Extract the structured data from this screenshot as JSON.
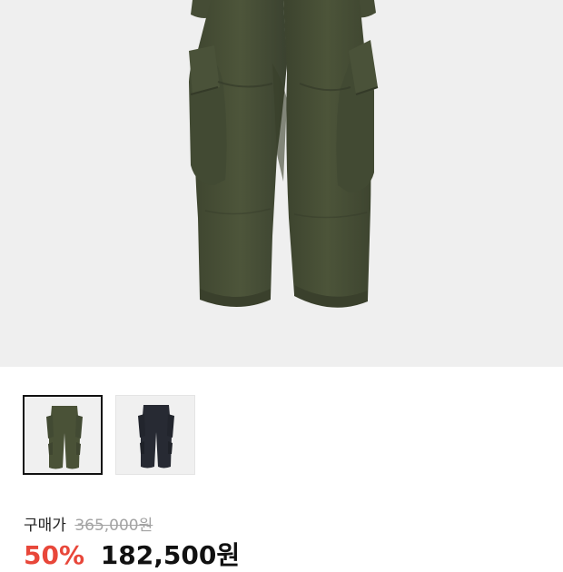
{
  "product": {
    "image_icon": "cargo-pants-image",
    "colors": [
      "#4a5237",
      "#272a33"
    ]
  },
  "thumbnails": [
    {
      "icon": "olive-cargo-pants-thumbnail",
      "selected": true
    },
    {
      "icon": "navy-cargo-pants-thumbnail",
      "selected": false
    }
  ],
  "pricing": {
    "label": "구매가",
    "original_price": "365,000원",
    "discount": "50%",
    "sale_price": "182,500원"
  },
  "colors": {
    "discount": "#e8473a",
    "original": "#a3a3a3",
    "hero_bg": "#efefef"
  }
}
